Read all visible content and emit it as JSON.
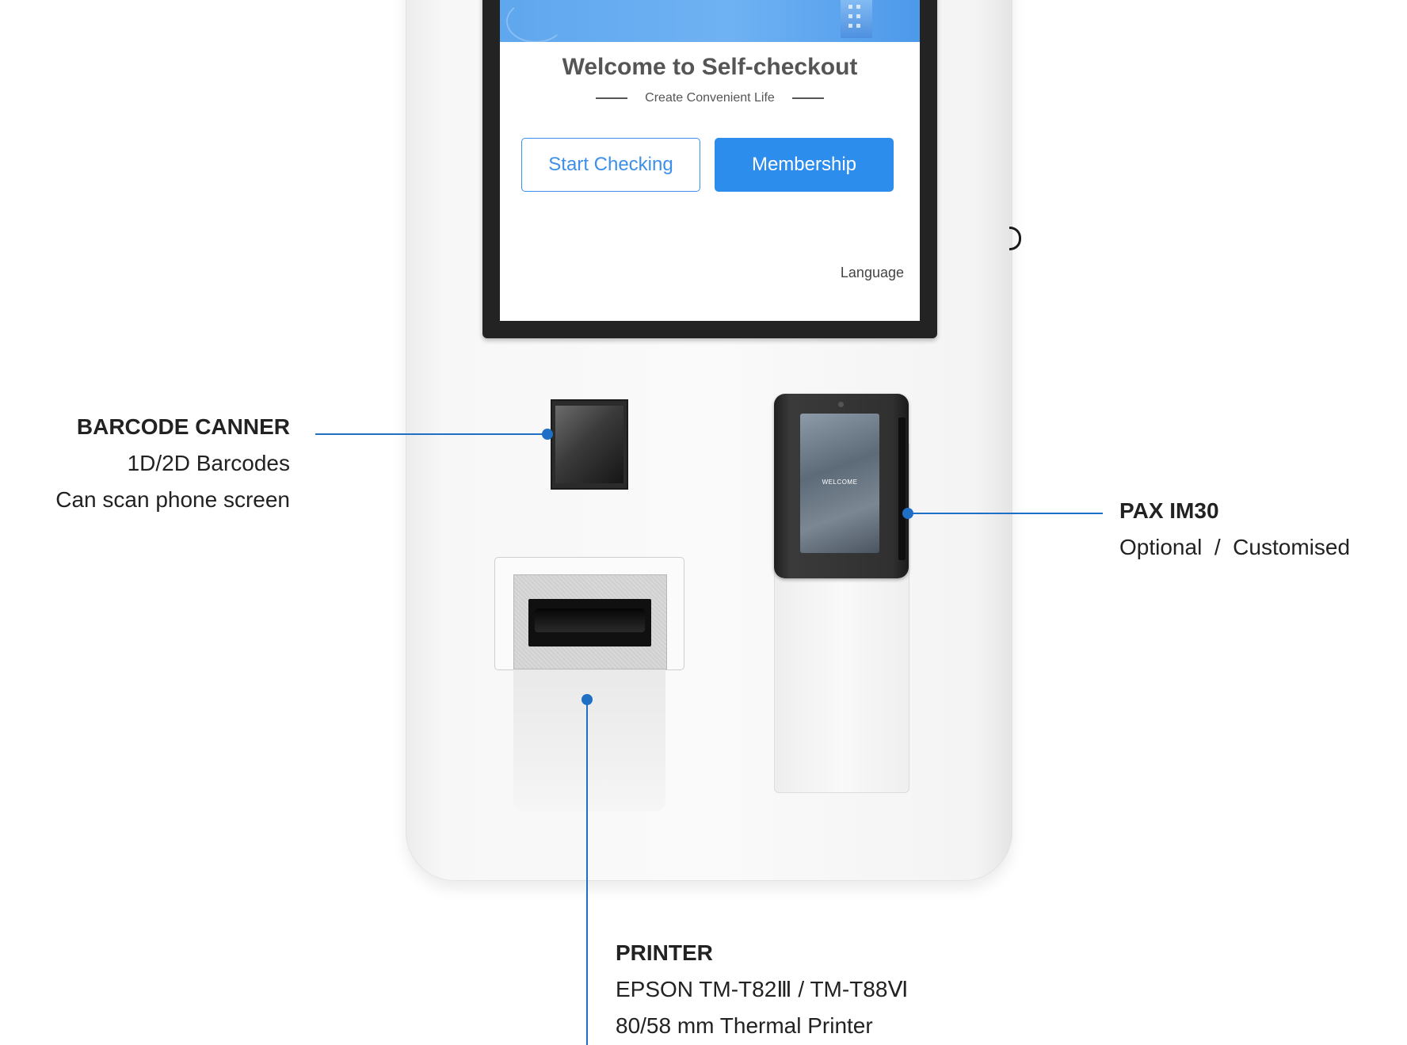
{
  "screen": {
    "title": "Welcome to Self-checkout",
    "subtitle": "Create Convenient Life",
    "start_button": "Start Checking",
    "membership_button": "Membership",
    "language_button": "Language"
  },
  "terminal": {
    "screen_text": "WELCOME"
  },
  "callouts": {
    "scanner": {
      "title": "BARCODE CANNER",
      "line1": "1D/2D Barcodes",
      "line2": "Can scan phone screen"
    },
    "terminal": {
      "title": "PAX IM30",
      "line1": "Optional  /  Customised"
    },
    "printer": {
      "title": "PRINTER",
      "line1": "EPSON TM-T82Ⅲ / TM-T88Ⅵ",
      "line2": "80/58 mm Thermal Printer"
    }
  },
  "colors": {
    "accent": "#2d8ded",
    "callout_line": "#1f6fc4"
  }
}
